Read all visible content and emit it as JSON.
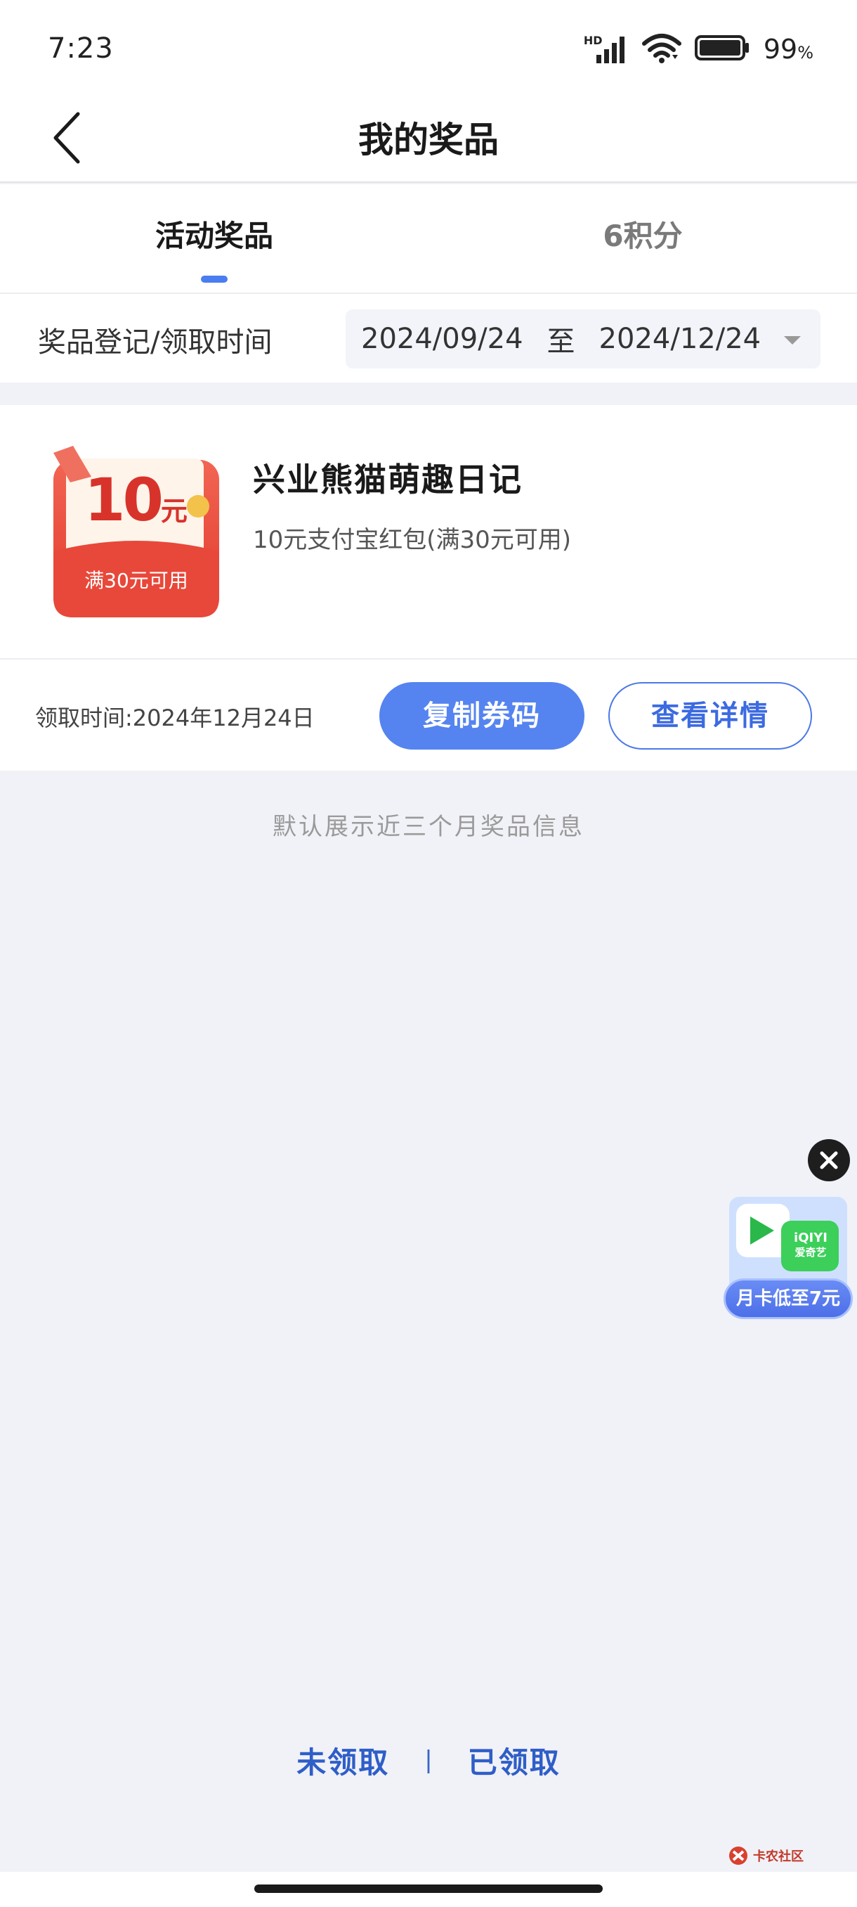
{
  "status_bar": {
    "time": "7:23",
    "network": "HD",
    "battery": "99",
    "battery_unit": "%"
  },
  "header": {
    "title": "我的奖品"
  },
  "tabs": [
    {
      "label": "活动奖品",
      "active": true
    },
    {
      "label": "6积分",
      "active": false
    }
  ],
  "filter": {
    "label": "奖品登记/领取时间",
    "start_date": "2024/09/24",
    "separator": "至",
    "end_date": "2024/12/24"
  },
  "prize": {
    "coupon_amount": "10",
    "coupon_unit": "元",
    "coupon_condition": "满30元可用",
    "name": "兴业熊猫萌趣日记",
    "description": "10元支付宝红包(满30元可用)",
    "claim_time": "领取时间:2024年12月24日",
    "copy_label": "复制券码",
    "detail_label": "查看详情"
  },
  "footnote": "默认展示近三个月奖品信息",
  "ad": {
    "brand": "iQIYI",
    "brand_cn": "爱奇艺",
    "label": "月卡低至7元"
  },
  "bottom_links": {
    "unclaimed": "未领取",
    "separator": "|",
    "claimed": "已领取"
  },
  "watermark": "卡农社区",
  "colors": {
    "accent": "#5584f0",
    "link": "#2f5ec8",
    "coupon_red": "#e8483a",
    "background": "#f1f2f7"
  }
}
